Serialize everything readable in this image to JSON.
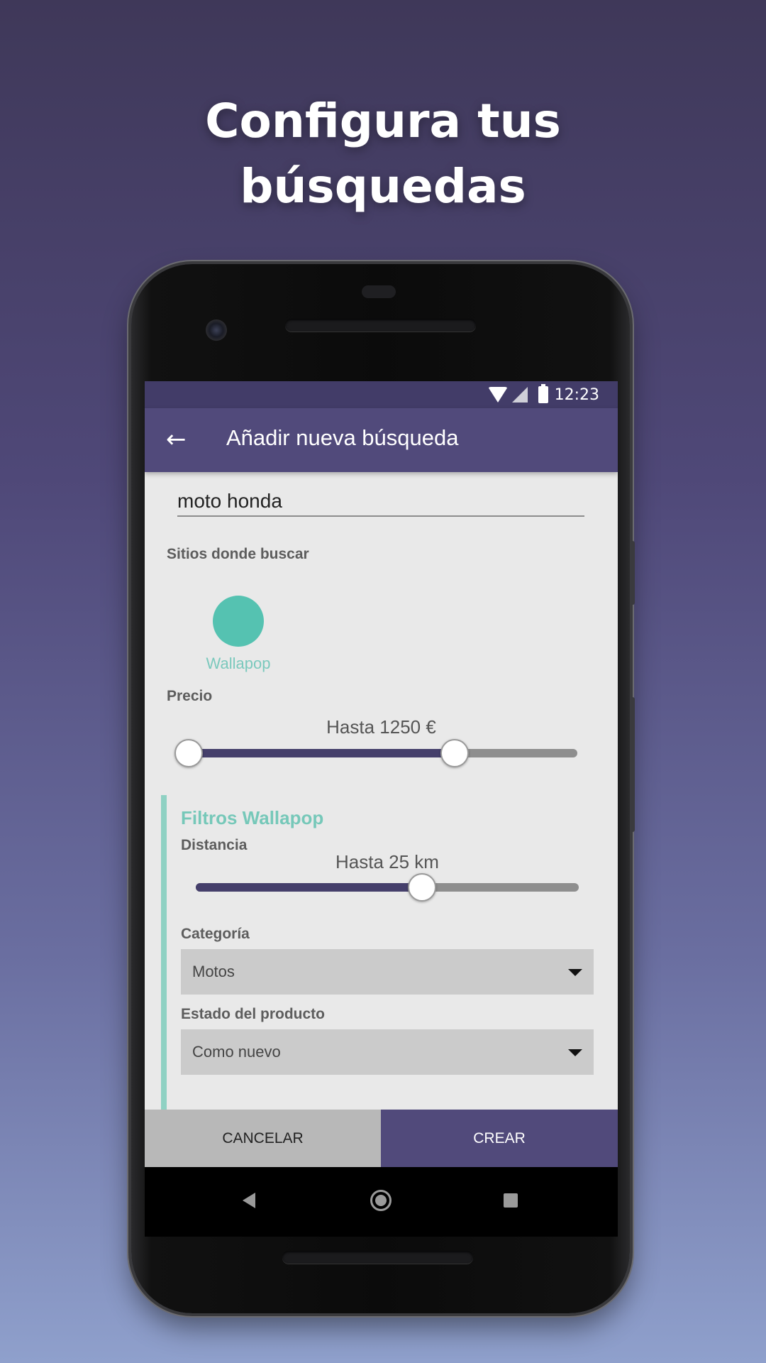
{
  "headline": {
    "line1": "Configura tus",
    "line2": "búsquedas"
  },
  "statusbar": {
    "time": "12:23"
  },
  "appbar": {
    "title": "Añadir nueva búsqueda",
    "back_icon": "arrow-left-icon"
  },
  "search": {
    "value": "moto honda"
  },
  "sites": {
    "label": "Sitios donde buscar",
    "items": [
      {
        "name": "Wallapop",
        "color": "#55c2b1"
      }
    ]
  },
  "price": {
    "label": "Precio",
    "value_text": "Hasta 1250 €",
    "range_min_fraction": 0.0,
    "range_max_fraction": 0.69
  },
  "filters": {
    "title": "Filtros Wallapop",
    "distance": {
      "label": "Distancia",
      "value_text": "Hasta 25 km",
      "fraction": 0.59
    },
    "category": {
      "label": "Categoría",
      "selected": "Motos"
    },
    "condition": {
      "label": "Estado del producto",
      "selected": "Como nuevo"
    }
  },
  "actions": {
    "cancel_label": "CANCELAR",
    "create_label": "CREAR"
  },
  "colors": {
    "primary": "#514a7b",
    "accent": "#55c2b1",
    "filters_accent": "#76c8b9"
  }
}
